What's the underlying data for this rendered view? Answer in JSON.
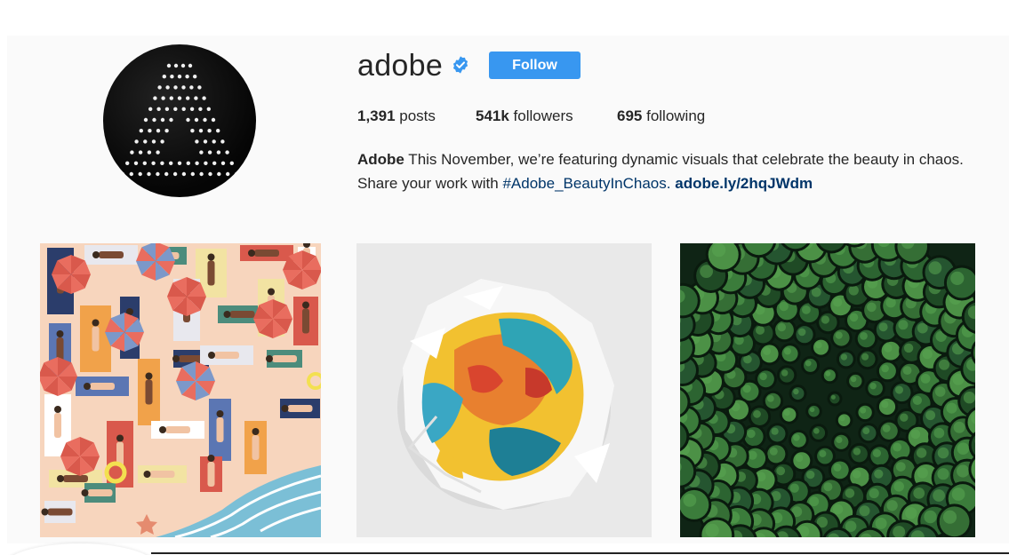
{
  "profile": {
    "username": "adobe",
    "verified": true,
    "follow_label": "Follow",
    "stats": {
      "posts_count": "1,391",
      "posts_label": " posts",
      "followers_count": "541k",
      "followers_label": " followers",
      "following_count": "695",
      "following_label": " following"
    },
    "bio": {
      "name": "Adobe",
      "text": " This November, we’re featuring dynamic visuals that celebrate the beauty in chaos. Share your work with ",
      "hashtag": "#Adobe_BeautyInChaos.",
      "link": "adobe.ly/2hqJWdm"
    }
  },
  "posts": [
    {
      "subject": "illustrated beach scene with umbrellas and sunbathers"
    },
    {
      "subject": "crumpled paper towel with colorful paint"
    },
    {
      "subject": "aerial view of spiraling forest treetops"
    }
  ],
  "colors": {
    "follow_button": "#3897f0",
    "verified_badge": "#3897f0",
    "link": "#003569",
    "text": "#262626",
    "panel_background": "#fafafa"
  },
  "icons": {
    "verified": "verified-badge-icon",
    "avatar": "adobe-logo"
  }
}
